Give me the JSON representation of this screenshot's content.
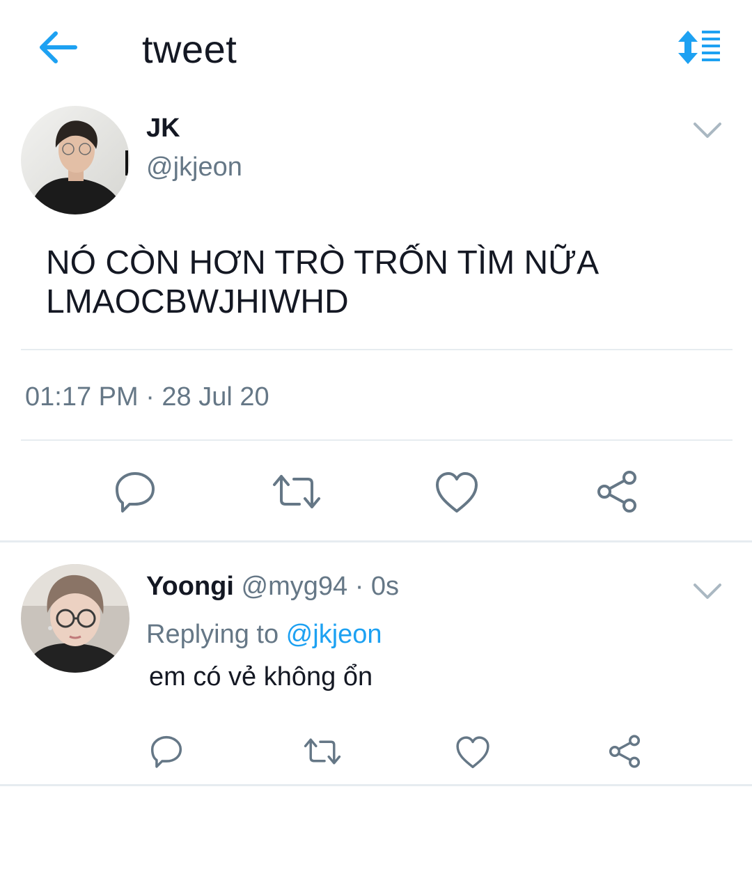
{
  "header": {
    "title": "tweet",
    "back_icon": "arrow-left-icon",
    "sort_icon": "sort-list-icon",
    "accent": "#1da1f2"
  },
  "main_tweet": {
    "name": "JK",
    "handle": "@jkjeon",
    "text": "NÓ CÒN HƠN TRÒ TRỐN TÌM NỮA\nLMAOCBWJHIWHD",
    "timestamp": "01:17 PM · 28 Jul 20",
    "actions": [
      "reply-icon",
      "retweet-icon",
      "like-icon",
      "share-icon"
    ]
  },
  "reply": {
    "name": "Yoongi",
    "handle": "@myg94",
    "separator": " · ",
    "time": "0s",
    "replying_prefix": "Replying to ",
    "replying_to": "@jkjeon",
    "text": "em có vẻ không ổn",
    "actions": [
      "reply-icon",
      "retweet-icon",
      "like-icon",
      "share-icon"
    ]
  },
  "colors": {
    "text": "#141823",
    "secondary": "#657786",
    "icon": "#657786",
    "link": "#1da1f2",
    "divider": "#e6ecf0"
  }
}
